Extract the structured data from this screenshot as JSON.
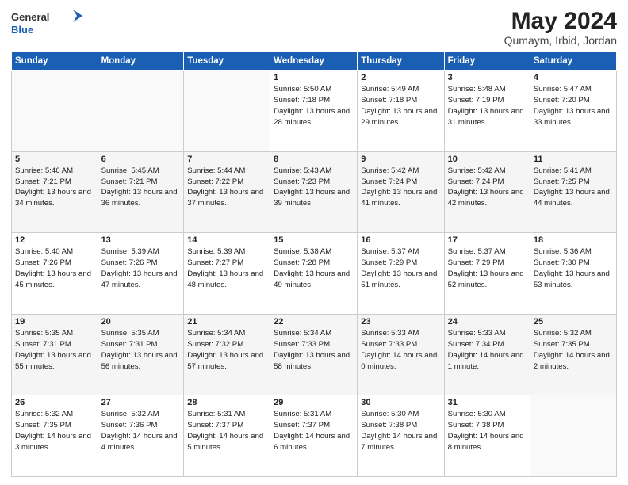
{
  "header": {
    "logo_general": "General",
    "logo_blue": "Blue",
    "month_title": "May 2024",
    "location": "Qumaym, Irbid, Jordan"
  },
  "weekdays": [
    "Sunday",
    "Monday",
    "Tuesday",
    "Wednesday",
    "Thursday",
    "Friday",
    "Saturday"
  ],
  "weeks": [
    [
      {
        "day": "",
        "sunrise": "",
        "sunset": "",
        "daylight": ""
      },
      {
        "day": "",
        "sunrise": "",
        "sunset": "",
        "daylight": ""
      },
      {
        "day": "",
        "sunrise": "",
        "sunset": "",
        "daylight": ""
      },
      {
        "day": "1",
        "sunrise": "Sunrise: 5:50 AM",
        "sunset": "Sunset: 7:18 PM",
        "daylight": "Daylight: 13 hours and 28 minutes."
      },
      {
        "day": "2",
        "sunrise": "Sunrise: 5:49 AM",
        "sunset": "Sunset: 7:18 PM",
        "daylight": "Daylight: 13 hours and 29 minutes."
      },
      {
        "day": "3",
        "sunrise": "Sunrise: 5:48 AM",
        "sunset": "Sunset: 7:19 PM",
        "daylight": "Daylight: 13 hours and 31 minutes."
      },
      {
        "day": "4",
        "sunrise": "Sunrise: 5:47 AM",
        "sunset": "Sunset: 7:20 PM",
        "daylight": "Daylight: 13 hours and 33 minutes."
      }
    ],
    [
      {
        "day": "5",
        "sunrise": "Sunrise: 5:46 AM",
        "sunset": "Sunset: 7:21 PM",
        "daylight": "Daylight: 13 hours and 34 minutes."
      },
      {
        "day": "6",
        "sunrise": "Sunrise: 5:45 AM",
        "sunset": "Sunset: 7:21 PM",
        "daylight": "Daylight: 13 hours and 36 minutes."
      },
      {
        "day": "7",
        "sunrise": "Sunrise: 5:44 AM",
        "sunset": "Sunset: 7:22 PM",
        "daylight": "Daylight: 13 hours and 37 minutes."
      },
      {
        "day": "8",
        "sunrise": "Sunrise: 5:43 AM",
        "sunset": "Sunset: 7:23 PM",
        "daylight": "Daylight: 13 hours and 39 minutes."
      },
      {
        "day": "9",
        "sunrise": "Sunrise: 5:42 AM",
        "sunset": "Sunset: 7:24 PM",
        "daylight": "Daylight: 13 hours and 41 minutes."
      },
      {
        "day": "10",
        "sunrise": "Sunrise: 5:42 AM",
        "sunset": "Sunset: 7:24 PM",
        "daylight": "Daylight: 13 hours and 42 minutes."
      },
      {
        "day": "11",
        "sunrise": "Sunrise: 5:41 AM",
        "sunset": "Sunset: 7:25 PM",
        "daylight": "Daylight: 13 hours and 44 minutes."
      }
    ],
    [
      {
        "day": "12",
        "sunrise": "Sunrise: 5:40 AM",
        "sunset": "Sunset: 7:26 PM",
        "daylight": "Daylight: 13 hours and 45 minutes."
      },
      {
        "day": "13",
        "sunrise": "Sunrise: 5:39 AM",
        "sunset": "Sunset: 7:26 PM",
        "daylight": "Daylight: 13 hours and 47 minutes."
      },
      {
        "day": "14",
        "sunrise": "Sunrise: 5:39 AM",
        "sunset": "Sunset: 7:27 PM",
        "daylight": "Daylight: 13 hours and 48 minutes."
      },
      {
        "day": "15",
        "sunrise": "Sunrise: 5:38 AM",
        "sunset": "Sunset: 7:28 PM",
        "daylight": "Daylight: 13 hours and 49 minutes."
      },
      {
        "day": "16",
        "sunrise": "Sunrise: 5:37 AM",
        "sunset": "Sunset: 7:29 PM",
        "daylight": "Daylight: 13 hours and 51 minutes."
      },
      {
        "day": "17",
        "sunrise": "Sunrise: 5:37 AM",
        "sunset": "Sunset: 7:29 PM",
        "daylight": "Daylight: 13 hours and 52 minutes."
      },
      {
        "day": "18",
        "sunrise": "Sunrise: 5:36 AM",
        "sunset": "Sunset: 7:30 PM",
        "daylight": "Daylight: 13 hours and 53 minutes."
      }
    ],
    [
      {
        "day": "19",
        "sunrise": "Sunrise: 5:35 AM",
        "sunset": "Sunset: 7:31 PM",
        "daylight": "Daylight: 13 hours and 55 minutes."
      },
      {
        "day": "20",
        "sunrise": "Sunrise: 5:35 AM",
        "sunset": "Sunset: 7:31 PM",
        "daylight": "Daylight: 13 hours and 56 minutes."
      },
      {
        "day": "21",
        "sunrise": "Sunrise: 5:34 AM",
        "sunset": "Sunset: 7:32 PM",
        "daylight": "Daylight: 13 hours and 57 minutes."
      },
      {
        "day": "22",
        "sunrise": "Sunrise: 5:34 AM",
        "sunset": "Sunset: 7:33 PM",
        "daylight": "Daylight: 13 hours and 58 minutes."
      },
      {
        "day": "23",
        "sunrise": "Sunrise: 5:33 AM",
        "sunset": "Sunset: 7:33 PM",
        "daylight": "Daylight: 14 hours and 0 minutes."
      },
      {
        "day": "24",
        "sunrise": "Sunrise: 5:33 AM",
        "sunset": "Sunset: 7:34 PM",
        "daylight": "Daylight: 14 hours and 1 minute."
      },
      {
        "day": "25",
        "sunrise": "Sunrise: 5:32 AM",
        "sunset": "Sunset: 7:35 PM",
        "daylight": "Daylight: 14 hours and 2 minutes."
      }
    ],
    [
      {
        "day": "26",
        "sunrise": "Sunrise: 5:32 AM",
        "sunset": "Sunset: 7:35 PM",
        "daylight": "Daylight: 14 hours and 3 minutes."
      },
      {
        "day": "27",
        "sunrise": "Sunrise: 5:32 AM",
        "sunset": "Sunset: 7:36 PM",
        "daylight": "Daylight: 14 hours and 4 minutes."
      },
      {
        "day": "28",
        "sunrise": "Sunrise: 5:31 AM",
        "sunset": "Sunset: 7:37 PM",
        "daylight": "Daylight: 14 hours and 5 minutes."
      },
      {
        "day": "29",
        "sunrise": "Sunrise: 5:31 AM",
        "sunset": "Sunset: 7:37 PM",
        "daylight": "Daylight: 14 hours and 6 minutes."
      },
      {
        "day": "30",
        "sunrise": "Sunrise: 5:30 AM",
        "sunset": "Sunset: 7:38 PM",
        "daylight": "Daylight: 14 hours and 7 minutes."
      },
      {
        "day": "31",
        "sunrise": "Sunrise: 5:30 AM",
        "sunset": "Sunset: 7:38 PM",
        "daylight": "Daylight: 14 hours and 8 minutes."
      },
      {
        "day": "",
        "sunrise": "",
        "sunset": "",
        "daylight": ""
      }
    ]
  ]
}
